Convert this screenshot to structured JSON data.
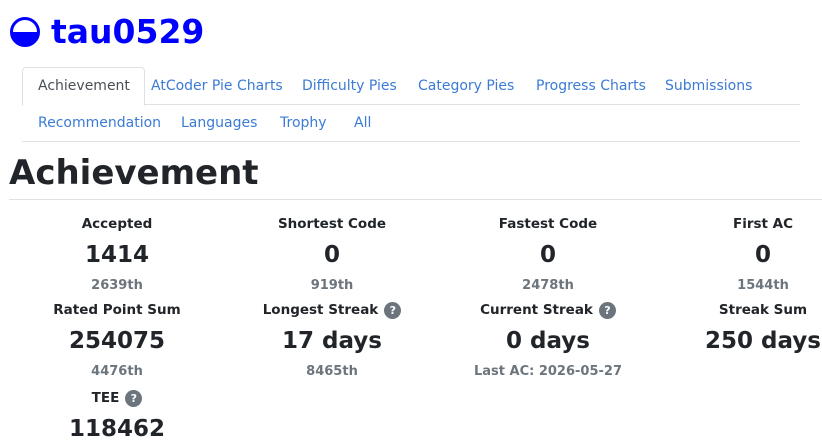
{
  "user": {
    "name": "tau0529"
  },
  "tabs": {
    "achievement": "Achievement",
    "atcoder_pie_charts": "AtCoder Pie Charts",
    "difficulty_pies": "Difficulty Pies",
    "category_pies": "Category Pies",
    "progress_charts": "Progress Charts",
    "submissions": "Submissions",
    "recommendation": "Recommendation",
    "languages": "Languages",
    "trophy": "Trophy",
    "all": "All"
  },
  "page_title": "Achievement",
  "help_glyph": "?",
  "stats": {
    "accepted": {
      "label": "Accepted",
      "value": "1414",
      "rank": "2639th"
    },
    "shortest_code": {
      "label": "Shortest Code",
      "value": "0",
      "rank": "919th"
    },
    "fastest_code": {
      "label": "Fastest Code",
      "value": "0",
      "rank": "2478th"
    },
    "first_ac": {
      "label": "First AC",
      "value": "0",
      "rank": "1544th"
    },
    "rated_point_sum": {
      "label": "Rated Point Sum",
      "value": "254075",
      "rank": "4476th"
    },
    "longest_streak": {
      "label": "Longest Streak",
      "value": "17 days",
      "rank": "8465th"
    },
    "current_streak": {
      "label": "Current Streak",
      "value": "0 days",
      "rank": "Last AC: 2026-05-27"
    },
    "streak_sum": {
      "label": "Streak Sum",
      "value": "250 days"
    },
    "tee": {
      "label": "TEE",
      "value": "118462"
    }
  },
  "colors": {
    "username": "#0000ff",
    "link": "#3b7bd5",
    "rank_icon": "#0000ff"
  }
}
